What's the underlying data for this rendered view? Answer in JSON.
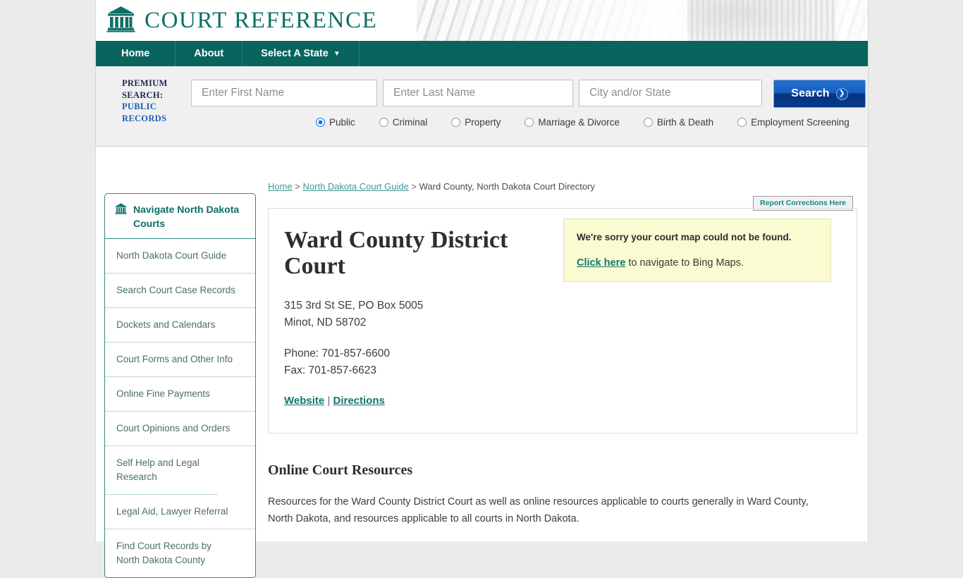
{
  "site": {
    "brand": "COURT REFERENCE",
    "logo_icon": "courthouse-icon"
  },
  "nav": {
    "items": [
      {
        "label": "Home"
      },
      {
        "label": "About"
      },
      {
        "label": "Select A State",
        "caret": "▼"
      }
    ]
  },
  "search": {
    "premium_line1": "PREMIUM",
    "premium_line2": "SEARCH:",
    "premium_line3": "PUBLIC",
    "premium_line4": "RECORDS",
    "first_name_placeholder": "Enter First Name",
    "first_name_value": "",
    "last_name_placeholder": "Enter Last Name",
    "last_name_value": "",
    "city_state_placeholder": "City and/or State",
    "city_state_value": "",
    "button_label": "Search",
    "button_icon": "chevron-right-icon",
    "options": [
      {
        "label": "Public",
        "selected": true
      },
      {
        "label": "Criminal",
        "selected": false
      },
      {
        "label": "Property",
        "selected": false
      },
      {
        "label": "Marriage & Divorce",
        "selected": false
      },
      {
        "label": "Birth & Death",
        "selected": false
      },
      {
        "label": "Employment Screening",
        "selected": false
      }
    ]
  },
  "breadcrumb": {
    "home": "Home",
    "sep1": " > ",
    "guide": "North Dakota Court Guide",
    "sep2": " > ",
    "current": "Ward County, North Dakota Court Directory"
  },
  "report_corrections": {
    "label": "Report Corrections Here"
  },
  "sidebar": {
    "header": "Navigate North Dakota Courts",
    "header_icon": "courthouse-icon",
    "items": [
      {
        "label": "North Dakota Court Guide"
      },
      {
        "label": "Search Court Case Records"
      },
      {
        "label": "Dockets and Calendars"
      },
      {
        "label": "Court Forms and Other Info"
      },
      {
        "label": "Online Fine Payments"
      },
      {
        "label": "Court Opinions and Orders"
      },
      {
        "label": "Self Help and Legal Research"
      },
      {
        "label": "Legal Aid, Lawyer Referral"
      },
      {
        "label": "Find Court Records by North Dakota County"
      }
    ]
  },
  "court": {
    "title": "Ward County District Court",
    "address_line1": "315 3rd St SE, PO Box 5005",
    "address_line2": "Minot, ND 58702",
    "phone": "Phone: 701-857-6600",
    "fax": "Fax: 701-857-6623",
    "website_label": "Website",
    "links_sep": " | ",
    "directions_label": "Directions"
  },
  "map_notice": {
    "message": "We're sorry your court map could not be found.",
    "link_label": "Click here",
    "after_link": " to navigate to Bing Maps."
  },
  "resources": {
    "heading": "Online Court Resources",
    "paragraph": "Resources for the Ward County District Court as well as online resources applicable to courts generally in Ward County, North Dakota, and resources applicable to all courts in North Dakota."
  },
  "colors": {
    "brand_teal": "#0d7068",
    "nav_teal": "#09645d",
    "link_teal": "#12776e",
    "search_blue": "#1a5fbf",
    "notice_yellow": "#fbfbd2"
  }
}
